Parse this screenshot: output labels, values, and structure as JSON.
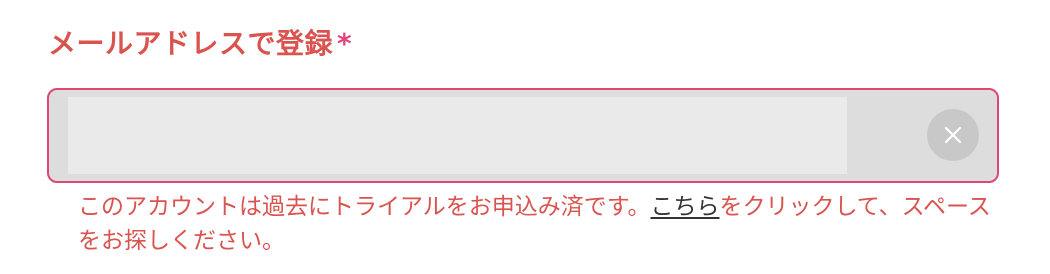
{
  "form": {
    "label": "メールアドレスで登録",
    "required_mark": "*",
    "input_value": "",
    "input_placeholder": "",
    "error": {
      "before_link": "このアカウントは過去にトライアルをお申込み済です。",
      "link_text": "こちら",
      "after_link": "をクリックして、スペースをお探しください。"
    }
  },
  "colors": {
    "label": "#d9534f",
    "required": "#e0457b",
    "input_border": "#e0476e",
    "error_text": "#d9534f",
    "link_text": "#333333"
  },
  "icons": {
    "clear": "close-icon"
  }
}
